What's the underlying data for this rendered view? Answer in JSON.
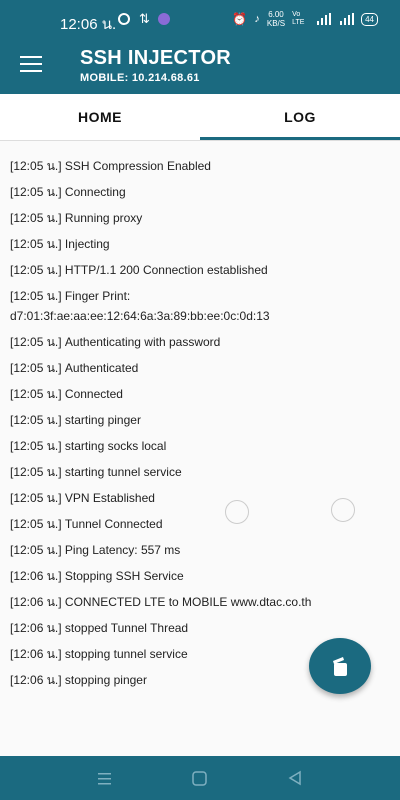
{
  "status_bar": {
    "time": "12:06 น.",
    "speed_value": "6.00",
    "speed_unit": "KB/S",
    "volte": "Vo LTE",
    "battery": "44",
    "icons": [
      "messenger-icon",
      "arrow-icon",
      "app-icon",
      "alarm-icon",
      "mute-icon",
      "signal-icon",
      "4g-signal-icon",
      "battery-icon"
    ]
  },
  "app_bar": {
    "title": "SSH INJECTOR",
    "subtitle": "MOBILE: 10.214.68.61"
  },
  "tabs": [
    {
      "label": "HOME",
      "active": false
    },
    {
      "label": "LOG",
      "active": true
    }
  ],
  "log": [
    "[12:05 น.] SSH Compression Enabled",
    "[12:05 น.] Connecting",
    "[12:05 น.] Running proxy",
    "[12:05 น.] Injecting",
    "[12:05 น.] HTTP/1.1 200 Connection established",
    "[12:05 น.] Finger Print:\nd7:01:3f:ae:aa:ee:12:64:6a:3a:89:bb:ee:0c:0d:13",
    "[12:05 น.] Authenticating with password",
    "[12:05 น.] Authenticated",
    "[12:05 น.] Connected",
    "[12:05 น.] starting pinger",
    "[12:05 น.] starting socks local",
    "[12:05 น.] starting tunnel service",
    "[12:05 น.] VPN Established",
    "[12:05 น.] Tunnel Connected",
    "[12:05 น.] Ping Latency: 557 ms",
    "[12:06 น.] Stopping SSH Service",
    "[12:06 น.] CONNECTED LTE to MOBILE www.dtac.co.th",
    "[12:06 น.] stopped Tunnel Thread",
    "[12:06 น.] stopping tunnel service",
    "[12:06 น.] stopping pinger"
  ],
  "colors": {
    "primary": "#1b6a80",
    "background": "#fafafa"
  }
}
